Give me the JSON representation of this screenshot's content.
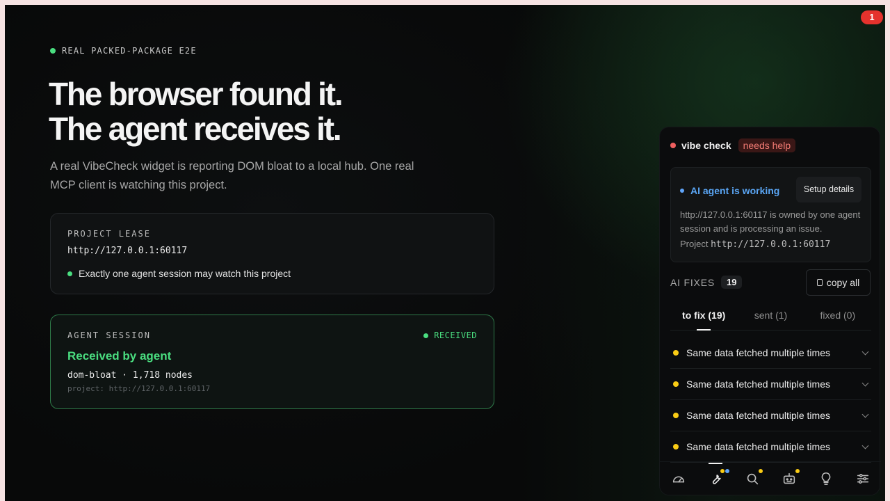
{
  "notification_count": "1",
  "hero": {
    "eyebrow": "REAL PACKED-PACKAGE E2E",
    "headline_line1": "The browser found it.",
    "headline_line2": "The agent receives it.",
    "lede": "A real VibeCheck widget is reporting DOM bloat to a local hub. One real MCP client is watching this project."
  },
  "lease_card": {
    "label": "PROJECT LEASE",
    "url": "http://127.0.0.1:60117",
    "note": "Exactly one agent session may watch this project"
  },
  "session_card": {
    "label": "AGENT SESSION",
    "status": "RECEIVED",
    "title": "Received by agent",
    "detail": "dom-bloat · 1,718 nodes",
    "project": "project: http://127.0.0.1:60117"
  },
  "widget": {
    "title": "vibe check",
    "status": "needs help",
    "agent_status": "AI agent is working",
    "setup_label": "Setup details",
    "agent_desc": "http://127.0.0.1:60117 is owned by one agent session and is processing an issue.",
    "project_label": "Project",
    "project_url": "http://127.0.0.1:60117",
    "fixes_label": "AI FIXES",
    "fixes_count": "19",
    "copy_label": "copy all",
    "tabs": [
      {
        "label": "to fix (19)"
      },
      {
        "label": "sent (1)"
      },
      {
        "label": "fixed (0)"
      }
    ],
    "issues": [
      {
        "label": "Same data fetched multiple times"
      },
      {
        "label": "Same data fetched multiple times"
      },
      {
        "label": "Same data fetched multiple times"
      },
      {
        "label": "Same data fetched multiple times"
      }
    ],
    "nav_icons": [
      "gauge-icon",
      "wrench-icon",
      "search-icon",
      "robot-icon",
      "lightbulb-icon",
      "sliders-icon"
    ]
  },
  "colors": {
    "accent_green": "#4ade80",
    "status_red": "#ef5f5f",
    "agent_blue": "#5aa6f5",
    "issue_yellow": "#facc15"
  }
}
